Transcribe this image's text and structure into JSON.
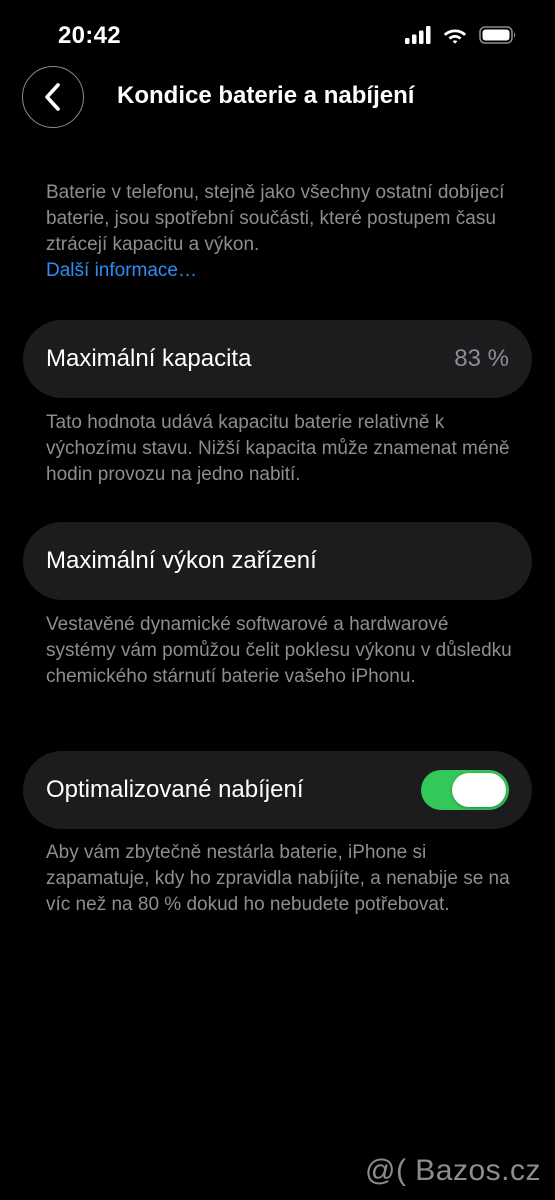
{
  "status_bar": {
    "time": "20:42",
    "icons": [
      "signal-icon",
      "wifi-icon",
      "battery-icon"
    ]
  },
  "nav": {
    "back_icon": "chevron-left-icon",
    "title": "Kondice baterie a nabíjení"
  },
  "intro": {
    "text": "Baterie v telefonu, stejně jako všechny ostatní dobíjecí baterie, jsou spotřební součásti, které postupem času ztrácejí kapacitu a výkon.",
    "link": "Další informace…"
  },
  "capacity": {
    "label": "Maximální kapacita",
    "value": "83 %",
    "footnote": "Tato hodnota udává kapacitu baterie relativně k výchozímu stavu. Nižší kapacita může znamenat méně hodin provozu na jedno nabití."
  },
  "performance": {
    "label": "Maximální výkon zařízení",
    "footnote": "Vestavěné dynamické softwarové a hardwarové systémy vám pomůžou čelit poklesu výkonu v důsledku chemického stárnutí baterie vašeho iPhonu."
  },
  "optimized_charging": {
    "label": "Optimalizované nabíjení",
    "enabled": true,
    "footnote": "Aby vám zbytečně nestárla baterie, iPhone si zapamatuje, kdy ho zpravidla nabíjíte, a nenabije se na víc než na 80 % dokud ho nebudete potřebovat."
  },
  "watermark": "@( Bazos.cz",
  "colors": {
    "background": "#000000",
    "row_background": "#1c1c1e",
    "secondary_text": "#8d8d92",
    "link": "#2f8cf5",
    "toggle_on": "#34c759"
  }
}
